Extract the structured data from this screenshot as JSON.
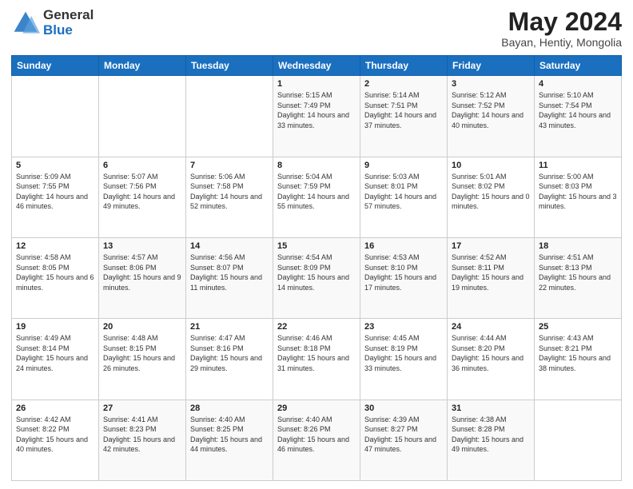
{
  "header": {
    "logo_general": "General",
    "logo_blue": "Blue",
    "title": "May 2024",
    "subtitle": "Bayan, Hentiy, Mongolia"
  },
  "days_of_week": [
    "Sunday",
    "Monday",
    "Tuesday",
    "Wednesday",
    "Thursday",
    "Friday",
    "Saturday"
  ],
  "weeks": [
    [
      {
        "day": "",
        "sunrise": "",
        "sunset": "",
        "daylight": ""
      },
      {
        "day": "",
        "sunrise": "",
        "sunset": "",
        "daylight": ""
      },
      {
        "day": "",
        "sunrise": "",
        "sunset": "",
        "daylight": ""
      },
      {
        "day": "1",
        "sunrise": "Sunrise: 5:15 AM",
        "sunset": "Sunset: 7:49 PM",
        "daylight": "Daylight: 14 hours and 33 minutes."
      },
      {
        "day": "2",
        "sunrise": "Sunrise: 5:14 AM",
        "sunset": "Sunset: 7:51 PM",
        "daylight": "Daylight: 14 hours and 37 minutes."
      },
      {
        "day": "3",
        "sunrise": "Sunrise: 5:12 AM",
        "sunset": "Sunset: 7:52 PM",
        "daylight": "Daylight: 14 hours and 40 minutes."
      },
      {
        "day": "4",
        "sunrise": "Sunrise: 5:10 AM",
        "sunset": "Sunset: 7:54 PM",
        "daylight": "Daylight: 14 hours and 43 minutes."
      }
    ],
    [
      {
        "day": "5",
        "sunrise": "Sunrise: 5:09 AM",
        "sunset": "Sunset: 7:55 PM",
        "daylight": "Daylight: 14 hours and 46 minutes."
      },
      {
        "day": "6",
        "sunrise": "Sunrise: 5:07 AM",
        "sunset": "Sunset: 7:56 PM",
        "daylight": "Daylight: 14 hours and 49 minutes."
      },
      {
        "day": "7",
        "sunrise": "Sunrise: 5:06 AM",
        "sunset": "Sunset: 7:58 PM",
        "daylight": "Daylight: 14 hours and 52 minutes."
      },
      {
        "day": "8",
        "sunrise": "Sunrise: 5:04 AM",
        "sunset": "Sunset: 7:59 PM",
        "daylight": "Daylight: 14 hours and 55 minutes."
      },
      {
        "day": "9",
        "sunrise": "Sunrise: 5:03 AM",
        "sunset": "Sunset: 8:01 PM",
        "daylight": "Daylight: 14 hours and 57 minutes."
      },
      {
        "day": "10",
        "sunrise": "Sunrise: 5:01 AM",
        "sunset": "Sunset: 8:02 PM",
        "daylight": "Daylight: 15 hours and 0 minutes."
      },
      {
        "day": "11",
        "sunrise": "Sunrise: 5:00 AM",
        "sunset": "Sunset: 8:03 PM",
        "daylight": "Daylight: 15 hours and 3 minutes."
      }
    ],
    [
      {
        "day": "12",
        "sunrise": "Sunrise: 4:58 AM",
        "sunset": "Sunset: 8:05 PM",
        "daylight": "Daylight: 15 hours and 6 minutes."
      },
      {
        "day": "13",
        "sunrise": "Sunrise: 4:57 AM",
        "sunset": "Sunset: 8:06 PM",
        "daylight": "Daylight: 15 hours and 9 minutes."
      },
      {
        "day": "14",
        "sunrise": "Sunrise: 4:56 AM",
        "sunset": "Sunset: 8:07 PM",
        "daylight": "Daylight: 15 hours and 11 minutes."
      },
      {
        "day": "15",
        "sunrise": "Sunrise: 4:54 AM",
        "sunset": "Sunset: 8:09 PM",
        "daylight": "Daylight: 15 hours and 14 minutes."
      },
      {
        "day": "16",
        "sunrise": "Sunrise: 4:53 AM",
        "sunset": "Sunset: 8:10 PM",
        "daylight": "Daylight: 15 hours and 17 minutes."
      },
      {
        "day": "17",
        "sunrise": "Sunrise: 4:52 AM",
        "sunset": "Sunset: 8:11 PM",
        "daylight": "Daylight: 15 hours and 19 minutes."
      },
      {
        "day": "18",
        "sunrise": "Sunrise: 4:51 AM",
        "sunset": "Sunset: 8:13 PM",
        "daylight": "Daylight: 15 hours and 22 minutes."
      }
    ],
    [
      {
        "day": "19",
        "sunrise": "Sunrise: 4:49 AM",
        "sunset": "Sunset: 8:14 PM",
        "daylight": "Daylight: 15 hours and 24 minutes."
      },
      {
        "day": "20",
        "sunrise": "Sunrise: 4:48 AM",
        "sunset": "Sunset: 8:15 PM",
        "daylight": "Daylight: 15 hours and 26 minutes."
      },
      {
        "day": "21",
        "sunrise": "Sunrise: 4:47 AM",
        "sunset": "Sunset: 8:16 PM",
        "daylight": "Daylight: 15 hours and 29 minutes."
      },
      {
        "day": "22",
        "sunrise": "Sunrise: 4:46 AM",
        "sunset": "Sunset: 8:18 PM",
        "daylight": "Daylight: 15 hours and 31 minutes."
      },
      {
        "day": "23",
        "sunrise": "Sunrise: 4:45 AM",
        "sunset": "Sunset: 8:19 PM",
        "daylight": "Daylight: 15 hours and 33 minutes."
      },
      {
        "day": "24",
        "sunrise": "Sunrise: 4:44 AM",
        "sunset": "Sunset: 8:20 PM",
        "daylight": "Daylight: 15 hours and 36 minutes."
      },
      {
        "day": "25",
        "sunrise": "Sunrise: 4:43 AM",
        "sunset": "Sunset: 8:21 PM",
        "daylight": "Daylight: 15 hours and 38 minutes."
      }
    ],
    [
      {
        "day": "26",
        "sunrise": "Sunrise: 4:42 AM",
        "sunset": "Sunset: 8:22 PM",
        "daylight": "Daylight: 15 hours and 40 minutes."
      },
      {
        "day": "27",
        "sunrise": "Sunrise: 4:41 AM",
        "sunset": "Sunset: 8:23 PM",
        "daylight": "Daylight: 15 hours and 42 minutes."
      },
      {
        "day": "28",
        "sunrise": "Sunrise: 4:40 AM",
        "sunset": "Sunset: 8:25 PM",
        "daylight": "Daylight: 15 hours and 44 minutes."
      },
      {
        "day": "29",
        "sunrise": "Sunrise: 4:40 AM",
        "sunset": "Sunset: 8:26 PM",
        "daylight": "Daylight: 15 hours and 46 minutes."
      },
      {
        "day": "30",
        "sunrise": "Sunrise: 4:39 AM",
        "sunset": "Sunset: 8:27 PM",
        "daylight": "Daylight: 15 hours and 47 minutes."
      },
      {
        "day": "31",
        "sunrise": "Sunrise: 4:38 AM",
        "sunset": "Sunset: 8:28 PM",
        "daylight": "Daylight: 15 hours and 49 minutes."
      },
      {
        "day": "",
        "sunrise": "",
        "sunset": "",
        "daylight": ""
      }
    ]
  ]
}
